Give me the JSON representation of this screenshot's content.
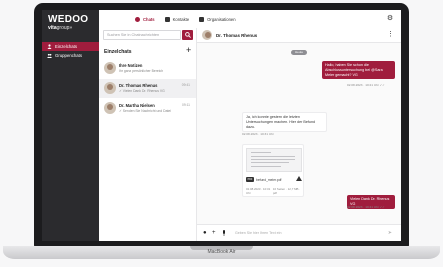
{
  "app": {
    "logo_main": "WEDOO",
    "logo_sub_a": "vita",
    "logo_sub_b": "group",
    "logo_arrows": "»"
  },
  "sidebar": {
    "items": [
      {
        "label": "Einzelchats",
        "icon": "user-icon",
        "active": true
      },
      {
        "label": "Gruppenchats",
        "icon": "group-icon",
        "active": false
      }
    ]
  },
  "topnav": {
    "tabs": [
      {
        "label": "Chats",
        "icon": "chat-icon",
        "active": true
      },
      {
        "label": "Kontakte",
        "icon": "contacts-icon",
        "active": false
      },
      {
        "label": "Organisationen",
        "icon": "organisation-icon",
        "active": false
      }
    ],
    "settings_icon": "gear-icon"
  },
  "chatlist": {
    "search_placeholder": "Suchen Sie in Chatnachrichten",
    "title": "Einzelchats",
    "items": [
      {
        "name": "Ihre Notizen",
        "preview": "Ihr ganz persönlicher Bereich",
        "time": ""
      },
      {
        "name": "Dr. Thomas Rhenus",
        "preview": "✓ Vielen Dank Dr. Rhenus VG",
        "time": "09:41"
      },
      {
        "name": "Dr. Martha Nielsen",
        "preview": "✓ Senden Sie Nachricht und Datei",
        "time": "09:11"
      }
    ]
  },
  "conversation": {
    "contact_name": "Dr. Thomas Rhenus",
    "day_label": "Heute",
    "messages": [
      {
        "direction": "out",
        "text": "Hallo, haben Sie schon die Abschlussuntersuchung bei @Sara Meier gemacht? VG",
        "meta": "02.08.2023 · 10:21 Uhr ✓✓"
      },
      {
        "direction": "in",
        "text": "Ja, ich konnte gestern die letzten Untersuchungen machen. Hier der Befund dazu.",
        "meta": "02.08.2023 · 10:31 Uhr"
      },
      {
        "direction": "out",
        "text": "Vielen Dank Dr. Rhenus VG",
        "meta": "02.08.2023 · 10:41 Uhr ✓✓"
      }
    ],
    "attachment": {
      "file_badge": "PDF",
      "file_name": "befund_meier.pdf",
      "meta_left": "02.08.2023 · 10:31 Uhr",
      "meta_right": "10 Seiten · 12,7 MB · pdf"
    },
    "composer_placeholder": "Geben Sie hier Ihren Text ein"
  },
  "device": {
    "model": "MacBook Air"
  },
  "colors": {
    "accent": "#a01d3d",
    "sidebar_bg": "#2b2b2e",
    "bezel": "#1c1c1e"
  }
}
